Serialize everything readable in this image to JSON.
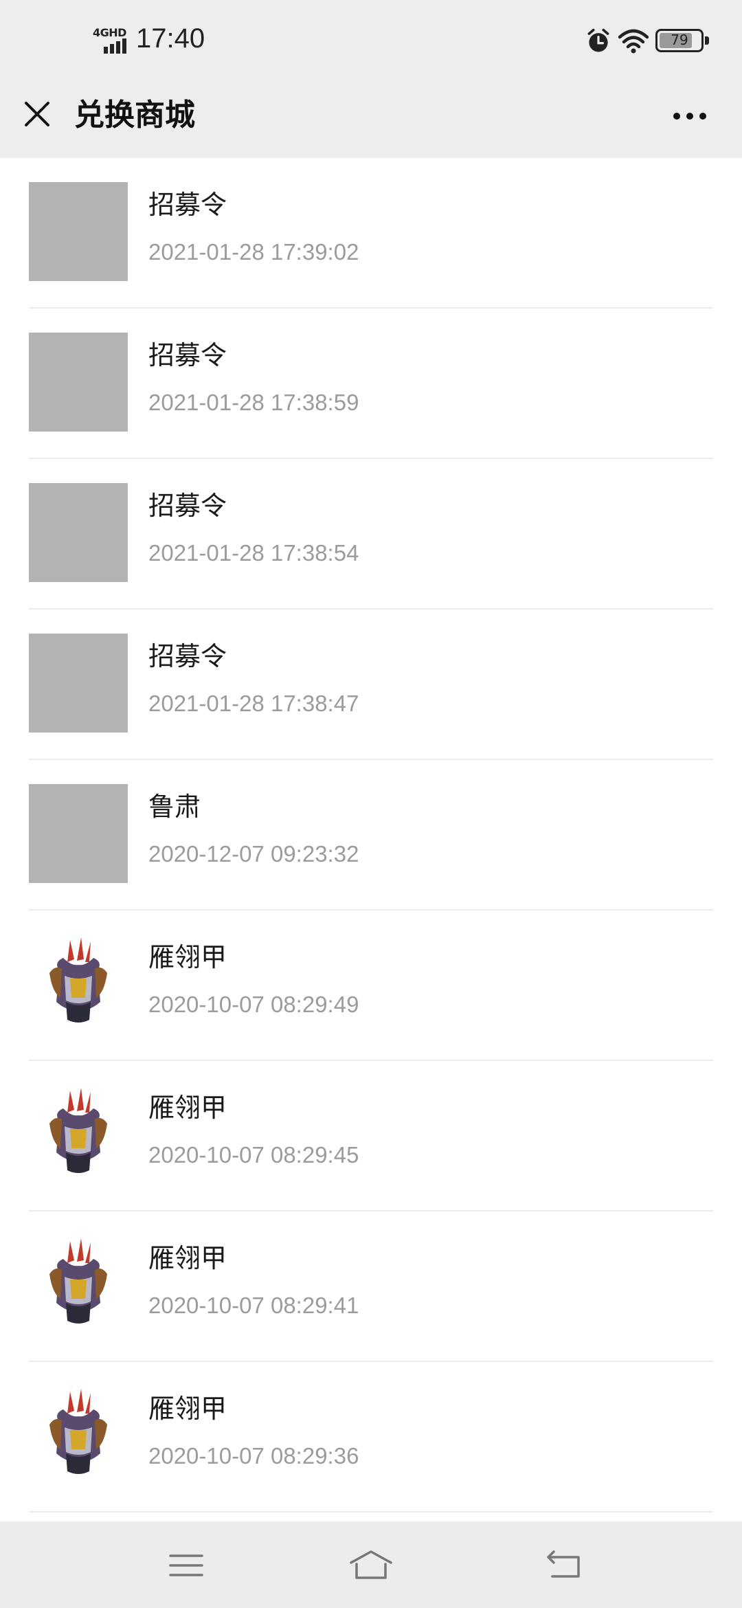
{
  "status_bar": {
    "network": "4GHD",
    "time": "17:40",
    "battery": "79",
    "icons": [
      "signal-icon",
      "alarm-icon",
      "wifi-icon",
      "battery-icon"
    ]
  },
  "header": {
    "title": "兑换商城",
    "close_icon": "close-icon",
    "more_icon": "more-icon"
  },
  "records": [
    {
      "name": "招募令",
      "time": "2021-01-28 17:39:02",
      "thumb": "placeholder"
    },
    {
      "name": "招募令",
      "time": "2021-01-28 17:38:59",
      "thumb": "placeholder"
    },
    {
      "name": "招募令",
      "time": "2021-01-28 17:38:54",
      "thumb": "placeholder"
    },
    {
      "name": "招募令",
      "time": "2021-01-28 17:38:47",
      "thumb": "placeholder"
    },
    {
      "name": "鲁肃",
      "time": "2020-12-07 09:23:32",
      "thumb": "placeholder"
    },
    {
      "name": "雁翎甲",
      "time": "2020-10-07 08:29:49",
      "thumb": "armor-icon"
    },
    {
      "name": "雁翎甲",
      "time": "2020-10-07 08:29:45",
      "thumb": "armor-icon"
    },
    {
      "name": "雁翎甲",
      "time": "2020-10-07 08:29:41",
      "thumb": "armor-icon"
    },
    {
      "name": "雁翎甲",
      "time": "2020-10-07 08:29:36",
      "thumb": "armor-icon"
    }
  ],
  "system_nav": {
    "icons": [
      "menu-icon",
      "home-icon",
      "back-icon"
    ]
  },
  "colors": {
    "bar_background": "#ededed",
    "placeholder": "#b3b3b3",
    "secondary_text": "#9b9b9b"
  }
}
